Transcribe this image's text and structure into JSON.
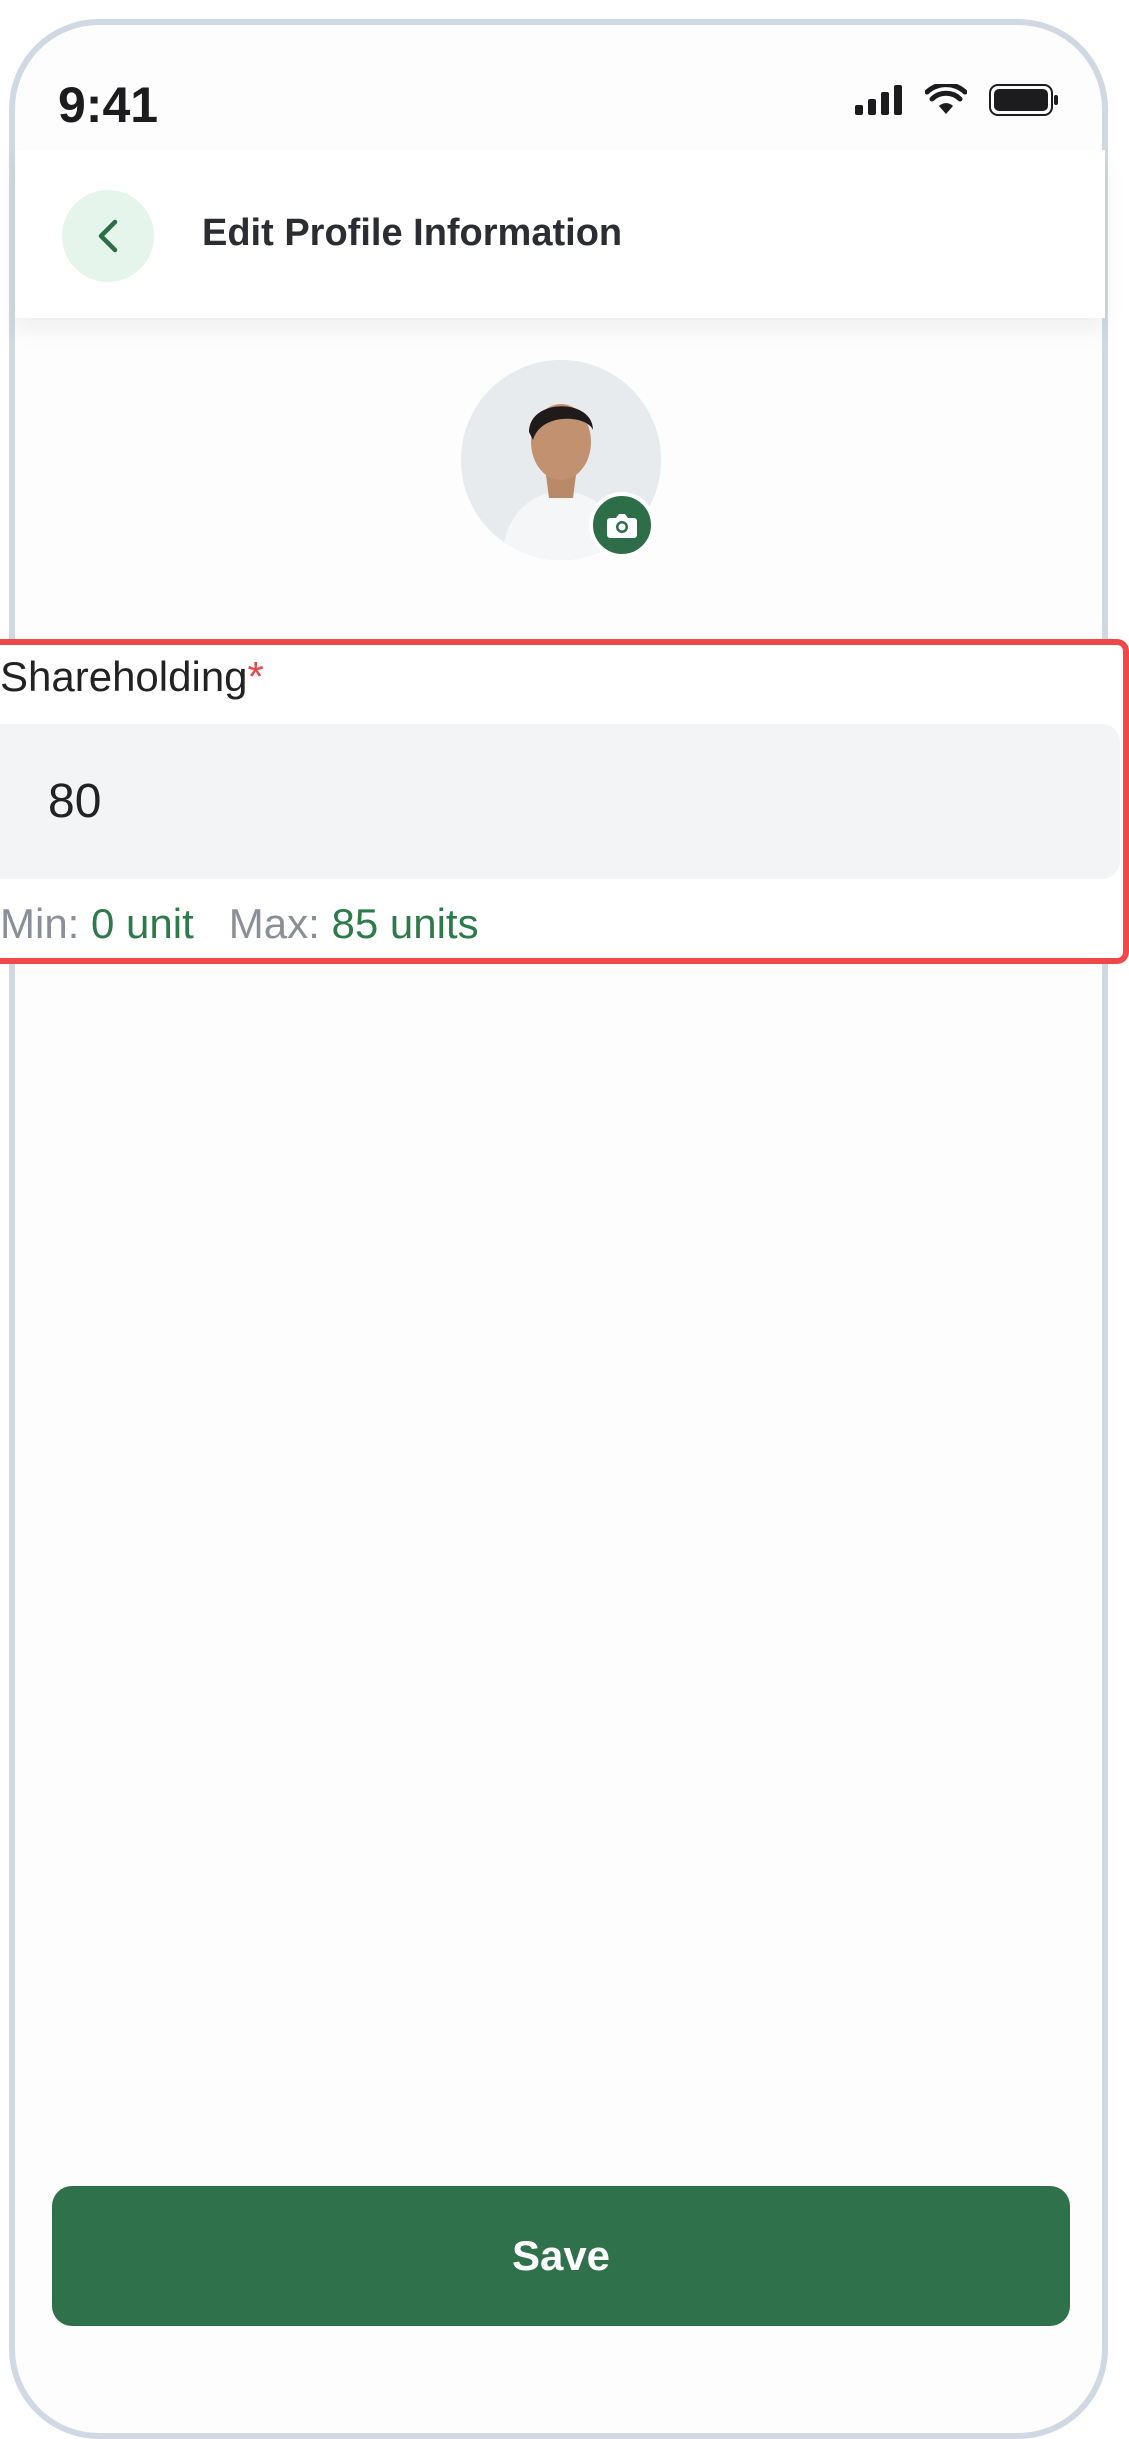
{
  "status_bar": {
    "time": "9:41"
  },
  "header": {
    "title": "Edit Profile Information"
  },
  "form": {
    "label": "Shareholding",
    "required_mark": "*",
    "value": "80",
    "hint": {
      "min_label": "Min:",
      "min_value": "0 unit",
      "max_label": "Max:",
      "max_value": "85 units"
    }
  },
  "actions": {
    "save_label": "Save"
  },
  "icons": [
    "back-arrow-icon",
    "camera-icon",
    "signal-icon",
    "wifi-icon",
    "battery-icon"
  ],
  "colors": {
    "primary": "#2f714a",
    "required": "#e54848",
    "highlight_border": "#f0484a"
  }
}
